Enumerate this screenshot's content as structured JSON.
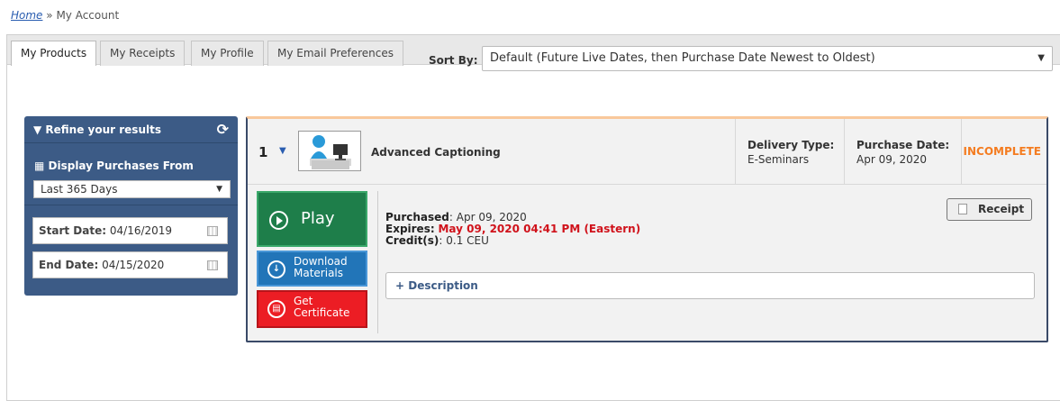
{
  "breadcrumb": {
    "home": "Home",
    "sep": "»",
    "current": "My Account"
  },
  "tabs": [
    {
      "label": "My Products"
    },
    {
      "label": "My Receipts"
    },
    {
      "label": "My Profile"
    },
    {
      "label": "My Email Preferences"
    }
  ],
  "sort": {
    "label": "Sort By:",
    "value": "Default (Future Live Dates, then Purchase Date Newest to Oldest)",
    "arrow": "▼"
  },
  "refine": {
    "title": "▼ Refine your results",
    "reset_icon": "⟳",
    "display_title": "▦ Display Purchases From",
    "range": "Last 365 Days",
    "start_label": "Start Date:",
    "start_value": "04/16/2019",
    "end_label": "End Date:",
    "end_value": "04/15/2020"
  },
  "product": {
    "number": "1",
    "caret": "▼",
    "title": "Advanced Captioning",
    "delivery_label": "Delivery Type:",
    "delivery_value": "E-Seminars",
    "purchase_label": "Purchase Date:",
    "purchase_value": "Apr 09, 2020",
    "status": "INCOMPLETE",
    "play": "Play",
    "download_1": "Download",
    "download_2": "Materials",
    "cert_1": "Get",
    "cert_2": "Certificate",
    "purchased_label": "Purchased",
    "purchased_value": ": Apr 09, 2020",
    "expires_label": "Expires:",
    "expires_value": "May 09, 2020 04:41 PM (Eastern)",
    "credits_label": "Credit(s)",
    "credits_value": ": 0.1 CEU",
    "receipt": "Receipt",
    "description": "+ Description"
  },
  "colors": {
    "accent": "#3c5b86",
    "status": "#f47c20",
    "play": "#1e7e4a",
    "download": "#2275b8",
    "certificate": "#ec1d24"
  }
}
